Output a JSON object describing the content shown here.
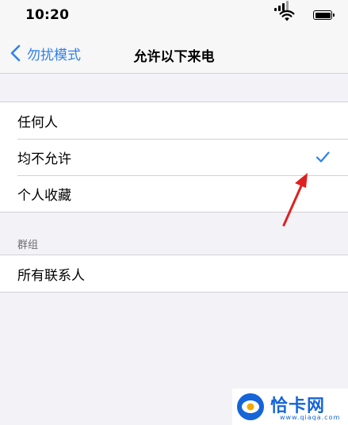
{
  "status_bar": {
    "time": "10:20",
    "icons": [
      "cellular-signal-icon",
      "wifi-icon",
      "battery-icon"
    ]
  },
  "nav": {
    "back_label": "勿扰模式",
    "title": "允许以下来电"
  },
  "options": {
    "items": [
      {
        "label": "任何人",
        "selected": false
      },
      {
        "label": "均不允许",
        "selected": true
      },
      {
        "label": "个人收藏",
        "selected": false
      }
    ]
  },
  "groups": {
    "header": "群组",
    "items": [
      {
        "label": "所有联系人"
      }
    ]
  },
  "watermark": {
    "brand": "恰卡网",
    "url": "www.qiaqa.com"
  },
  "colors": {
    "accent": "#2f80ed",
    "background": "#f2f2f7",
    "annotation": "#e02020",
    "watermark": "#1565d8"
  }
}
